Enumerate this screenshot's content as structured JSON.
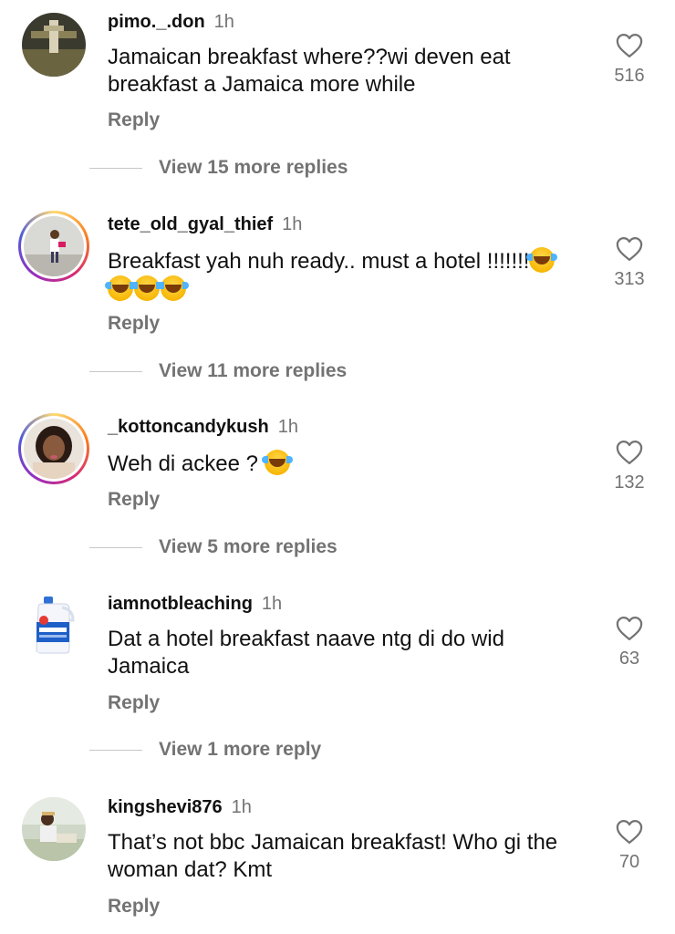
{
  "comments": [
    {
      "username": "pimo._.don",
      "time": "1h",
      "text": "Jamaican breakfast where??wi deven eat breakfast a Jamaica more while",
      "likes": "516",
      "reply_label": "Reply",
      "view_more": "View 15 more replies"
    },
    {
      "username": "tete_old_gyal_thief",
      "time": "1h",
      "text": "Breakfast yah nuh ready.. must a hotel !!!!!!!",
      "likes": "313",
      "reply_label": "Reply",
      "view_more": "View 11 more replies"
    },
    {
      "username": "_kottoncandykush",
      "time": "1h",
      "text": "Weh di ackee ?",
      "likes": "132",
      "reply_label": "Reply",
      "view_more": "View 5 more replies"
    },
    {
      "username": "iamnotbleaching",
      "time": "1h",
      "text": "Dat a hotel breakfast naave ntg di do wid Jamaica",
      "likes": "63",
      "reply_label": "Reply",
      "view_more": "View 1 more reply"
    },
    {
      "username": "kingshevi876",
      "time": "1h",
      "text": "That’s not bbc Jamaican breakfast! Who gi the woman dat? Kmt",
      "likes": "70",
      "reply_label": "Reply"
    }
  ],
  "icons": {
    "like": "heart-outline-icon",
    "emoji": "face-with-tears-of-joy-emoji"
  },
  "colors": {
    "muted": "#737373",
    "text": "#111111",
    "divider": "#c7c7c7"
  }
}
